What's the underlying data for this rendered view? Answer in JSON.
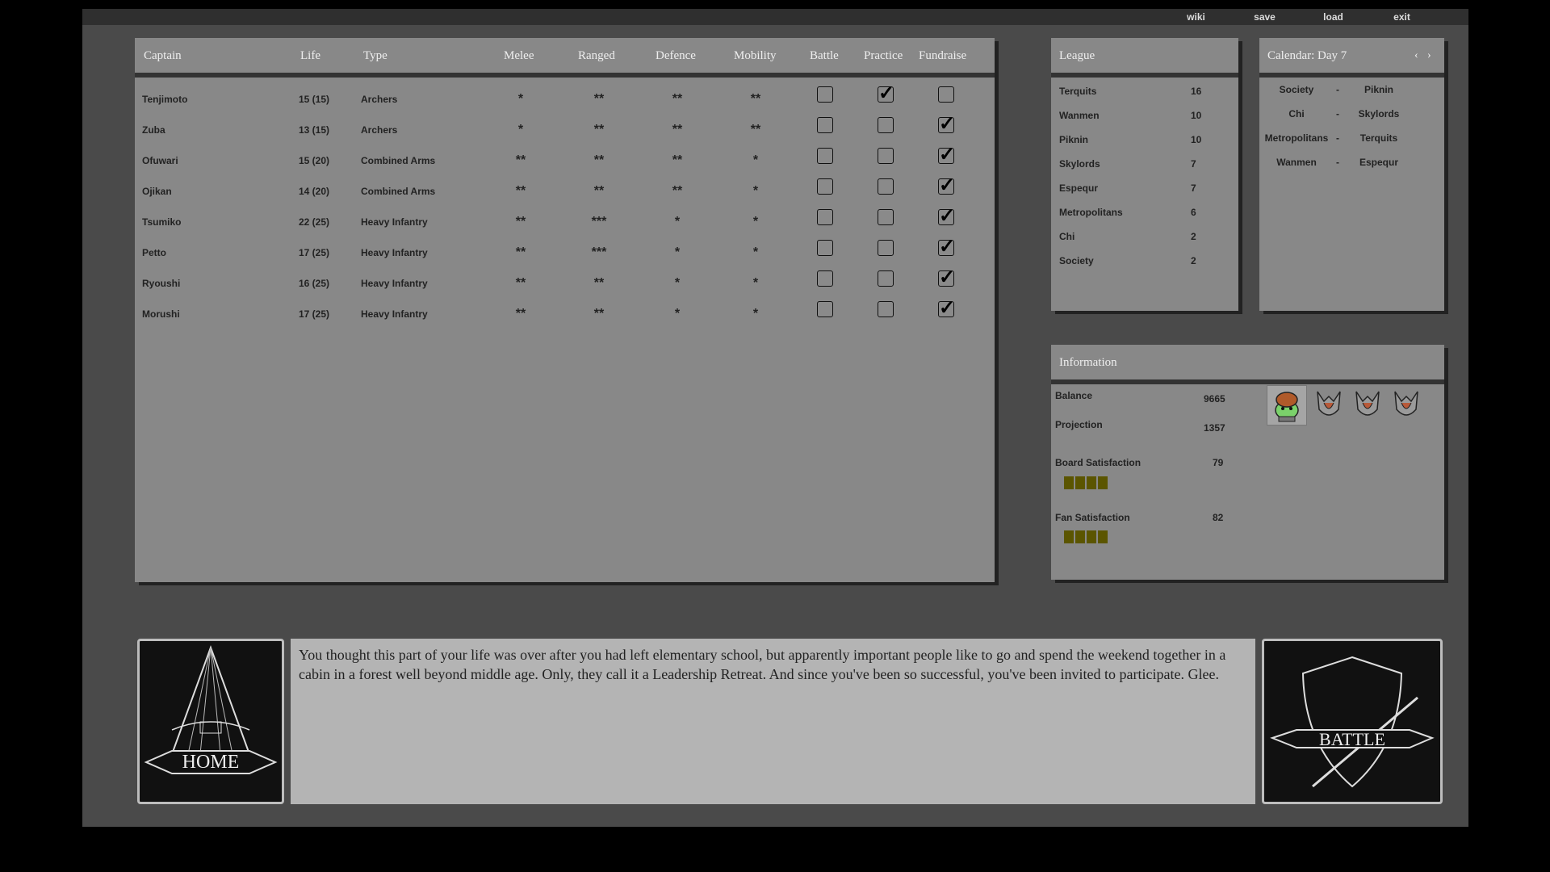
{
  "menu": {
    "wiki": "wiki",
    "save": "save",
    "load": "load",
    "exit": "exit"
  },
  "roster": {
    "headers": {
      "captain": "Captain",
      "life": "Life",
      "type": "Type",
      "melee": "Melee",
      "ranged": "Ranged",
      "defence": "Defence",
      "mobility": "Mobility",
      "battle": "Battle",
      "practice": "Practice",
      "fundraise": "Fundraise"
    },
    "rows": [
      {
        "name": "Tenjimoto",
        "life": "15 (15)",
        "type": "Archers",
        "melee": "*",
        "ranged": "**",
        "defence": "**",
        "mobility": "**",
        "battle": false,
        "practice": true,
        "fundraise": false
      },
      {
        "name": "Zuba",
        "life": "13 (15)",
        "type": "Archers",
        "melee": "*",
        "ranged": "**",
        "defence": "**",
        "mobility": "**",
        "battle": false,
        "practice": false,
        "fundraise": true
      },
      {
        "name": "Ofuwari",
        "life": "15 (20)",
        "type": "Combined Arms",
        "melee": "**",
        "ranged": "**",
        "defence": "**",
        "mobility": "*",
        "battle": false,
        "practice": false,
        "fundraise": true
      },
      {
        "name": "Ojikan",
        "life": "14 (20)",
        "type": "Combined Arms",
        "melee": "**",
        "ranged": "**",
        "defence": "**",
        "mobility": "*",
        "battle": false,
        "practice": false,
        "fundraise": true
      },
      {
        "name": "Tsumiko",
        "life": "22 (25)",
        "type": "Heavy Infantry",
        "melee": "**",
        "ranged": "***",
        "defence": "*",
        "mobility": "*",
        "battle": false,
        "practice": false,
        "fundraise": true
      },
      {
        "name": "Petto",
        "life": "17 (25)",
        "type": "Heavy Infantry",
        "melee": "**",
        "ranged": "***",
        "defence": "*",
        "mobility": "*",
        "battle": false,
        "practice": false,
        "fundraise": true
      },
      {
        "name": "Ryoushi",
        "life": "16 (25)",
        "type": "Heavy Infantry",
        "melee": "**",
        "ranged": "**",
        "defence": "*",
        "mobility": "*",
        "battle": false,
        "practice": false,
        "fundraise": true
      },
      {
        "name": "Morushi",
        "life": "17 (25)",
        "type": "Heavy Infantry",
        "melee": "**",
        "ranged": "**",
        "defence": "*",
        "mobility": "*",
        "battle": false,
        "practice": false,
        "fundraise": true
      }
    ]
  },
  "league": {
    "title": "League",
    "teams": [
      {
        "name": "Terquits",
        "points": "16"
      },
      {
        "name": "Wanmen",
        "points": "10"
      },
      {
        "name": "Piknin",
        "points": "10"
      },
      {
        "name": "Skylords",
        "points": "7"
      },
      {
        "name": "Espequr",
        "points": "7"
      },
      {
        "name": "Metropolitans",
        "points": "6"
      },
      {
        "name": "Chi",
        "points": "2"
      },
      {
        "name": "Society",
        "points": "2"
      }
    ]
  },
  "calendar": {
    "title": "Calendar: Day 7",
    "prev": "‹",
    "next": "›",
    "matches": [
      {
        "home": "Society",
        "sep": "-",
        "away": "Piknin"
      },
      {
        "home": "Chi",
        "sep": "-",
        "away": "Skylords"
      },
      {
        "home": "Metropolitans",
        "sep": "-",
        "away": "Terquits"
      },
      {
        "home": "Wanmen",
        "sep": "-",
        "away": "Espequr"
      }
    ]
  },
  "information": {
    "title": "Information",
    "balance_label": "Balance",
    "balance": "9665",
    "projection_label": "Projection",
    "projection": "1357",
    "board_label": "Board Satisfaction",
    "board": "79",
    "board_level": 4,
    "fan_label": "Fan Satisfaction",
    "fan": "82",
    "fan_level": 4
  },
  "story": {
    "home_label": "HOME",
    "battle_label": "BATTLE",
    "text": "You thought this part of your life was over after you had left elementary school, but apparently important people like to go and spend the weekend together in a cabin in a forest well beyond middle age. Only, they call it a Leadership Retreat. And since you've been so successful, you've been invited to participate. Glee."
  },
  "colors": {
    "panel": "#888888",
    "background": "#4a4a4a",
    "bar": "#5b5500",
    "story": "#b4b4b4"
  }
}
